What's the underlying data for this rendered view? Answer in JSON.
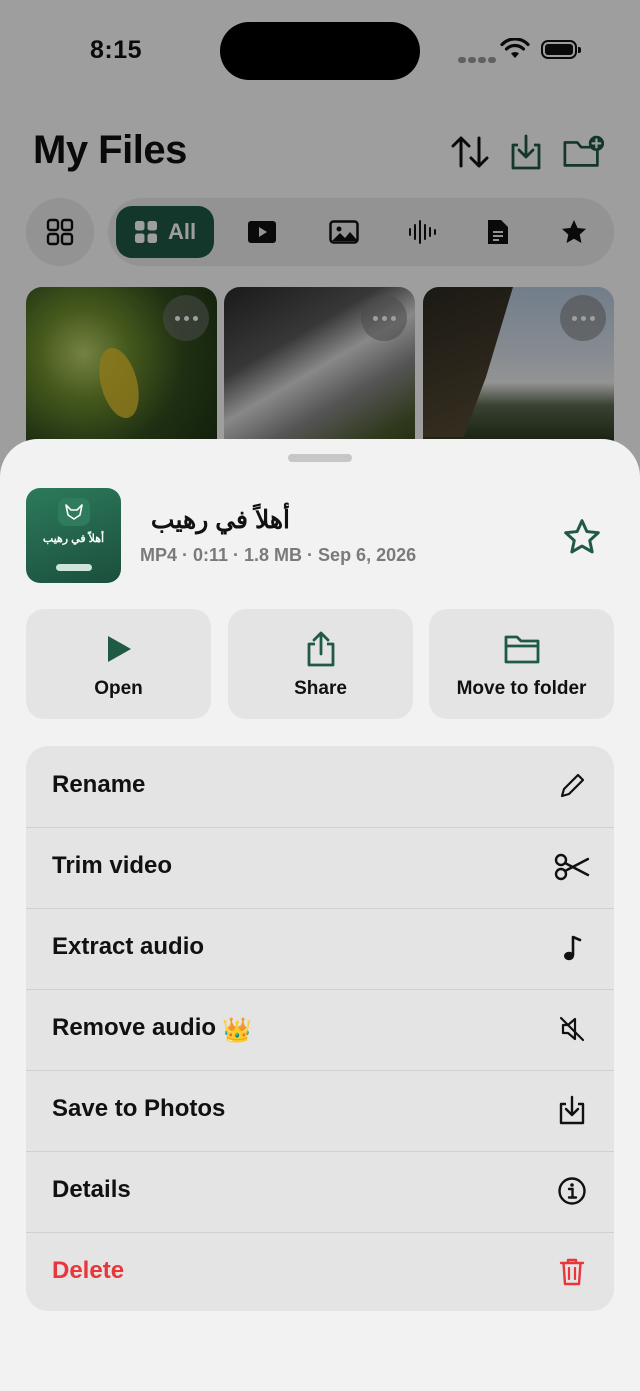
{
  "status_bar": {
    "time": "8:15"
  },
  "header": {
    "title": "My Files",
    "sort_icon": "sort-arrows-icon",
    "import_icon": "download-tray-icon",
    "new_folder_icon": "folder-plus-icon"
  },
  "filters": {
    "grid_toggle_icon": "grid-view-icon",
    "all_label": "All",
    "items": [
      "video-icon",
      "photo-icon",
      "audio-waveform-icon",
      "document-icon",
      "star-icon"
    ]
  },
  "sheet": {
    "file": {
      "thumb_title": "أهلاً في رهيب",
      "name": "أهلاً في رهيب",
      "meta": "MP4 · 0:11 · 1.8 MB · Sep 6, 2026"
    },
    "actions": [
      {
        "label": "Open",
        "icon": "play-icon"
      },
      {
        "label": "Share",
        "icon": "share-icon"
      },
      {
        "label": "Move to folder",
        "icon": "folder-icon"
      }
    ],
    "menu": [
      {
        "label": "Rename",
        "icon": "pencil-icon"
      },
      {
        "label": "Trim video",
        "icon": "scissors-icon"
      },
      {
        "label": "Extract audio",
        "icon": "music-note-icon"
      },
      {
        "label": "Remove audio",
        "icon": "speaker-slash-icon",
        "badge": "👑"
      },
      {
        "label": "Save to Photos",
        "icon": "save-download-icon"
      },
      {
        "label": "Details",
        "icon": "info-icon"
      },
      {
        "label": "Delete",
        "icon": "trash-icon"
      }
    ]
  },
  "colors": {
    "accent": "#1f5a44",
    "danger": "#e8363b"
  }
}
